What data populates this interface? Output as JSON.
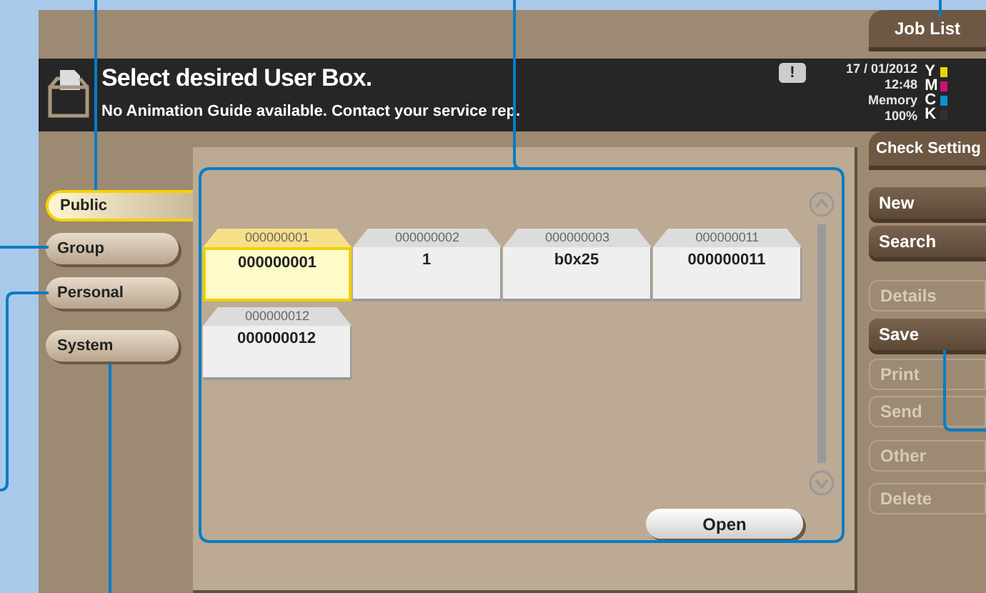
{
  "header": {
    "title": "Select desired User Box.",
    "message": "No Animation Guide available. Contact your service rep.",
    "alert": "!",
    "date": "17 / 01/2012",
    "time": "12:48",
    "memory_label": "Memory",
    "memory_value": "100%"
  },
  "toner": [
    {
      "label": "Y",
      "color": "#e8d800"
    },
    {
      "label": "M",
      "color": "#d0107a"
    },
    {
      "label": "C",
      "color": "#1090d0"
    },
    {
      "label": "K",
      "color": "#303030"
    }
  ],
  "top_buttons": [
    {
      "label": "Job List"
    },
    {
      "label": "Check Setting"
    }
  ],
  "categories": [
    {
      "label": "Public",
      "selected": true
    },
    {
      "label": "Group",
      "selected": false
    },
    {
      "label": "Personal",
      "selected": false
    },
    {
      "label": "System",
      "selected": false
    }
  ],
  "boxes": [
    {
      "number": "000000001",
      "name": "000000001",
      "selected": true
    },
    {
      "number": "000000002",
      "name": "1",
      "selected": false
    },
    {
      "number": "000000003",
      "name": "b0x25",
      "selected": false
    },
    {
      "number": "000000011",
      "name": "000000011",
      "selected": false
    },
    {
      "number": "000000012",
      "name": "000000012",
      "selected": false
    }
  ],
  "open_button": "Open",
  "actions": [
    {
      "label": "New",
      "disabled": false
    },
    {
      "label": "Search",
      "disabled": false
    },
    {
      "label": "Details",
      "disabled": true
    },
    {
      "label": "Save",
      "disabled": false
    },
    {
      "label": "Print",
      "disabled": true
    },
    {
      "label": "Send",
      "disabled": true
    },
    {
      "label": "Other",
      "disabled": true
    },
    {
      "label": "Delete",
      "disabled": true
    }
  ]
}
